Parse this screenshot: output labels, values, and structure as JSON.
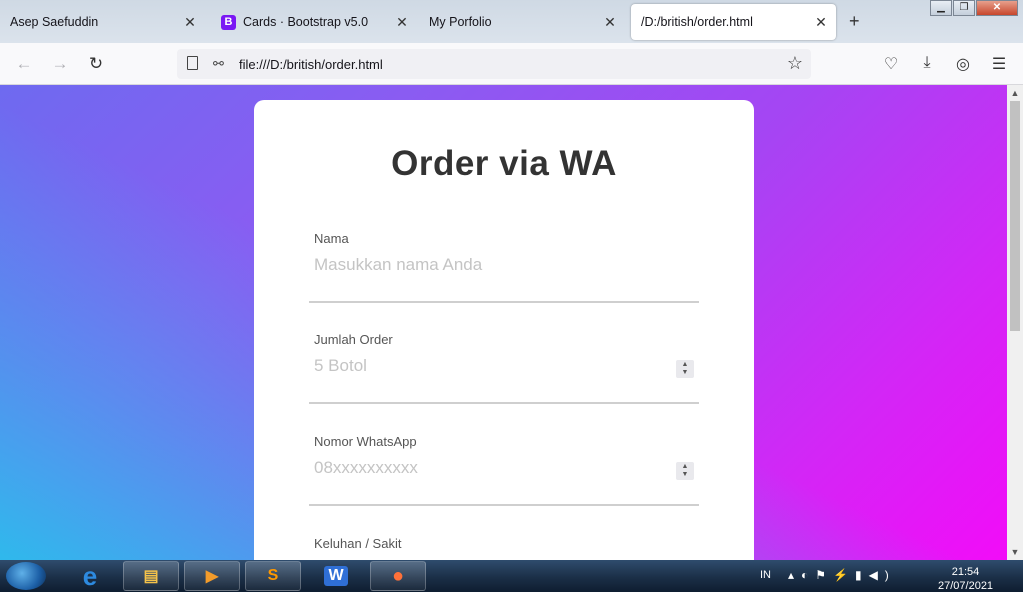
{
  "browser": {
    "tabs": [
      {
        "label": "Asep Saefuddin",
        "active": false
      },
      {
        "label": "Cards · Bootstrap v5.0",
        "active": false,
        "icon_letter": "B"
      },
      {
        "label": "My Porfolio",
        "active": false
      },
      {
        "label": "/D:/british/order.html",
        "active": true
      }
    ],
    "url": "file:///D:/british/order.html",
    "close_glyph": "✕",
    "new_tab_glyph": "+"
  },
  "form": {
    "title": "Order via WA",
    "fields": [
      {
        "label": "Nama",
        "placeholder": "Masukkan nama Anda",
        "type": "text"
      },
      {
        "label": "Jumlah Order",
        "placeholder": "5 Botol",
        "type": "number"
      },
      {
        "label": "Nomor WhatsApp",
        "placeholder": "08xxxxxxxxxx",
        "type": "number"
      },
      {
        "label": "Keluhan / Sakit",
        "placeholder": "",
        "type": "text"
      }
    ]
  },
  "taskbar": {
    "language": "IN",
    "time": "21:54",
    "date": "27/07/2021"
  },
  "colors": {
    "gradient_start": "#2abeec",
    "gradient_mid": "#8a5cf2",
    "gradient_end": "#f20cf8",
    "card_bg": "#ffffff",
    "title_color": "#333333"
  },
  "icons": {
    "back": "arrow-left-icon",
    "forward": "arrow-right-icon",
    "reload": "reload-icon",
    "bookmark": "star-icon",
    "pocket": "pocket-icon",
    "downloads": "download-icon",
    "account": "account-icon",
    "menu": "hamburger-menu-icon"
  }
}
